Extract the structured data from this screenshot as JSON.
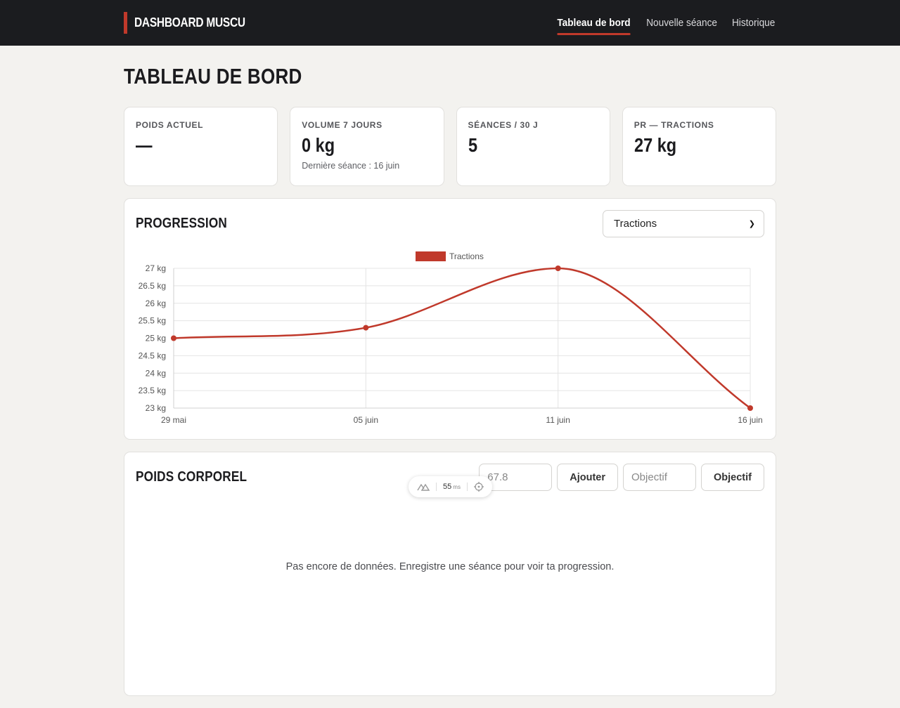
{
  "brand": {
    "name": "DASHBOARD MUSCU",
    "accent": "#c0392b"
  },
  "nav": {
    "items": [
      {
        "label": "Tableau de bord",
        "active": true
      },
      {
        "label": "Nouvelle séance",
        "active": false
      },
      {
        "label": "Historique",
        "active": false
      }
    ]
  },
  "page": {
    "title": "TABLEAU DE BORD"
  },
  "stats": [
    {
      "label": "POIDS ACTUEL",
      "value": "—",
      "sub": ""
    },
    {
      "label": "VOLUME 7 JOURS",
      "value": "0 kg",
      "sub": "Dernière séance : 16 juin"
    },
    {
      "label": "SÉANCES / 30 J",
      "value": "5",
      "sub": ""
    },
    {
      "label": "PR — TRACTIONS",
      "value": "27 kg",
      "sub": ""
    }
  ],
  "progression": {
    "title": "PROGRESSION",
    "select_value": "Tractions"
  },
  "chart_data": {
    "type": "line",
    "categories": [
      "29 mai",
      "05 juin",
      "11 juin",
      "16 juin"
    ],
    "series": [
      {
        "name": "Tractions",
        "values": [
          25,
          25.3,
          27,
          23
        ],
        "color": "#c0392b"
      }
    ],
    "ylim": [
      23,
      27
    ],
    "yticks": [
      "27 kg",
      "26.5 kg",
      "26 kg",
      "25.5 kg",
      "25 kg",
      "24.5 kg",
      "24 kg",
      "23.5 kg",
      "23 kg"
    ],
    "legend": "top-center",
    "grid": true
  },
  "weight": {
    "title": "POIDS CORPOREL",
    "weight_placeholder": "67.8",
    "add_label": "Ajouter",
    "goal_placeholder": "Objectif",
    "goal_button": "Objectif",
    "empty_message": "Pas encore de données. Enregistre une séance pour voir ta progression."
  },
  "devtools": {
    "timing": "55",
    "unit": "ms"
  }
}
